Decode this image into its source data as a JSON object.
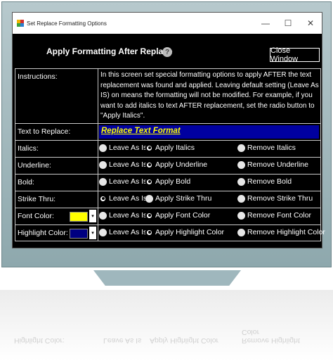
{
  "window": {
    "title": "Set Replace Formatting Options",
    "controls": {
      "minimize": "—",
      "maximize": "☐",
      "close": "✕"
    }
  },
  "header": {
    "title": "Apply Formatting After Replace",
    "help": "?",
    "close_button": "Close Window"
  },
  "instructions": {
    "label": "Instructions:",
    "text": "In this screen set special formatting options to apply AFTER the text replacement was found and applied. Leaving default setting (Leave As IS) on means the formatting will not be modified. For example, if you want to add italics to text AFTER replacement, set the radio button to \"Apply Italics\"."
  },
  "text_to_replace": {
    "label": "Text to Replace:",
    "value": "Replace Text Format"
  },
  "rows": [
    {
      "label": "Italics:",
      "opts": [
        "Leave As Is",
        "Apply Italics",
        "Remove Italics"
      ],
      "selected": 1
    },
    {
      "label": "Underline:",
      "opts": [
        "Leave As Is",
        "Apply Underline",
        "Remove Underline"
      ],
      "selected": 1
    },
    {
      "label": "Bold:",
      "opts": [
        "Leave As Is",
        "Apply Bold",
        "Remove Bold"
      ],
      "selected": 1
    },
    {
      "label": "Strike Thru:",
      "opts": [
        "Leave As Is",
        "Apply Strike Thru",
        "Remove Strike Thru"
      ],
      "selected": 0
    },
    {
      "label": "Font Color:",
      "opts": [
        "Leave As Is",
        "Apply Font Color",
        "Remove Font Color"
      ],
      "selected": 1,
      "swatch": "#ffff00"
    },
    {
      "label": "Highlight Color:",
      "opts": [
        "Leave As Is",
        "Apply Highlight Color",
        "Remove Highlight Color"
      ],
      "selected": 1,
      "swatch": "#000080"
    }
  ],
  "colors": {
    "background": "#000000",
    "accent_bar": "#0000a0",
    "accent_text": "#ffff00",
    "monitor": "#9fb7bd"
  }
}
